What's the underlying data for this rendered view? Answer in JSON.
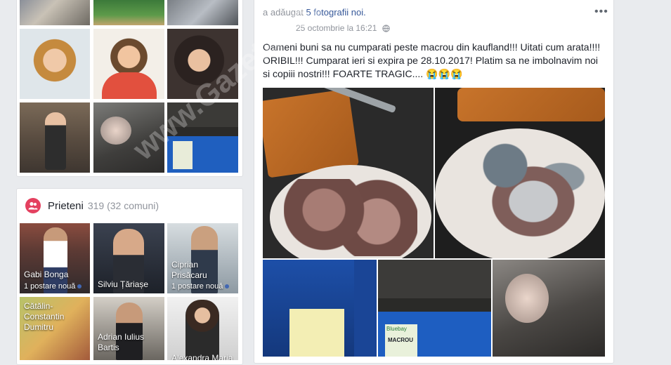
{
  "friends": {
    "title": "Prieteni",
    "count": "319 (32 comuni)",
    "tiles": [
      {
        "name": "Gabi Bonga",
        "note": "1 postare nouă"
      },
      {
        "name": "Silviu Țăriașe",
        "note": ""
      },
      {
        "name": "Ciprian Prisăcaru",
        "note": "1 postare nouă"
      },
      {
        "name": "Cătălin-Constantin Dumitru",
        "note": ""
      },
      {
        "name": "Adrian Iulius Bartis",
        "note": ""
      },
      {
        "name": "Alexandra Maria",
        "note": ""
      }
    ]
  },
  "post": {
    "header_action": "a adăugat",
    "header_link": "5 fotografii noi.",
    "timestamp": "25 octombrie la 16:21",
    "text_lines": [
      "Oameni buni sa nu cumparati peste macrou din kaufland!!! Uitati cum arata!!!!",
      "ORIBIL!!! Cumparat ieri si expira pe 28.10.2017! Platim sa ne imbolnavim noi",
      "si copiii nostri!!! FOARTE TRAGIC.... 😭😭😭"
    ],
    "more_label": "•••"
  },
  "package_label": {
    "brand": "Bluebay",
    "product": "MACROU"
  },
  "icons": {
    "friends": "people-icon",
    "globe": "globe-icon",
    "more": "more-options-icon"
  },
  "colors": {
    "background": "#e9ebee",
    "link": "#365899",
    "friends_icon": "#e4405f"
  }
}
